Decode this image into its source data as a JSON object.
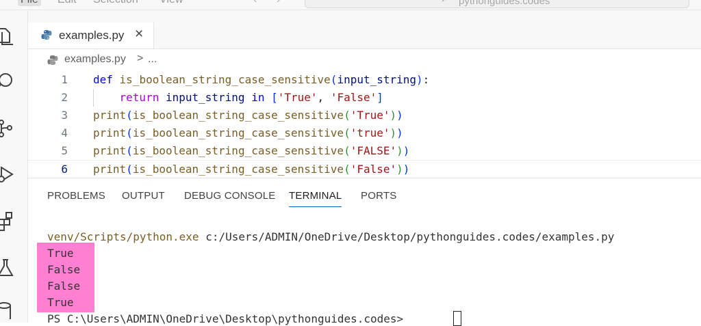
{
  "menu": {
    "file": "File",
    "edit": "Edit",
    "selection": "Selection",
    "view": "View"
  },
  "command_center": {
    "text": "pythonguides.codes"
  },
  "tab": {
    "label": "examples.py",
    "close": "×"
  },
  "breadcrumb": {
    "file": "examples.py",
    "separator": ">",
    "more": "..."
  },
  "editor": {
    "lines": [
      {
        "number": "1"
      },
      {
        "number": "2"
      },
      {
        "number": "3"
      },
      {
        "number": "4"
      },
      {
        "number": "5"
      },
      {
        "number": "6"
      }
    ],
    "tokens": {
      "def": "def",
      "func_name": "is_boolean_string_case_sensitive",
      "param": "input_string",
      "return_kw": "return",
      "in_kw": "in",
      "print": "print",
      "s_True": "'True'",
      "s_False": "'False'",
      "s_true": "'true'",
      "s_FALSE": "'FALSE'"
    }
  },
  "panel": {
    "tabs": [
      "PROBLEMS",
      "OUTPUT",
      "DEBUG CONSOLE",
      "TERMINAL",
      "PORTS"
    ],
    "active_tab": "TERMINAL"
  },
  "terminal": {
    "command_exe": "venv/Scripts/python.exe",
    "command_arg": "c:/Users/ADMIN/OneDrive/Desktop/pythonguides.codes/examples.py",
    "output": [
      "True",
      "False",
      "False",
      "True"
    ],
    "prompt": "PS C:\\Users\\ADMIN\\OneDrive\\Desktop\\pythonguides.codes>"
  },
  "colors": {
    "highlight": "#ff80d2",
    "keyword": "#0000ff",
    "control_keyword": "#af00db",
    "function": "#795e26",
    "string": "#a31515",
    "variable": "#001080",
    "active_tab_underline": "#005fb8"
  }
}
